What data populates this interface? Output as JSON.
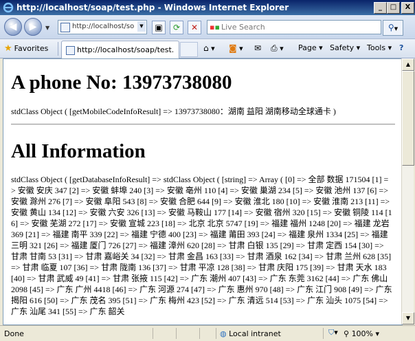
{
  "window": {
    "title": "http://localhost/soap/test.php - Windows Internet Explorer",
    "minimize": "_",
    "maximize": "□",
    "close": "X"
  },
  "nav": {
    "address": "http://localhost/soap/test.php",
    "search_placeholder": "Live Search"
  },
  "tabs": {
    "favorites_label": "Favorites",
    "active_tab": "http://localhost/soap/test.php",
    "page_label": "Page",
    "safety_label": "Safety",
    "tools_label": "Tools"
  },
  "content": {
    "heading1": "A phone No: 13973738080",
    "result1": "stdClass Object ( [getMobileCodeInfoResult] => 13973738080：湖南 益阳 湖南移动全球通卡 )",
    "heading2": "All Information",
    "result2": "stdClass Object ( [getDatabaseInfoResult] => stdClass Object ( [string] => Array ( [0] => 全部 数据 171504 [1] => 安徽 安庆 347 [2] => 安徽 蚌埠 240 [3] => 安徽 亳州 110 [4] => 安徽 巢湖 234 [5] => 安徽 池州 137 [6] => 安徽 滁州 276 [7] => 安徽 阜阳 543 [8] => 安徽 合肥 644 [9] => 安徽 淮北 180 [10] => 安徽 淮南 213 [11] => 安徽 黄山 134 [12] => 安徽 六安 326 [13] => 安徽 马鞍山 177 [14] => 安徽 宿州 320 [15] => 安徽 铜陵 114 [16] => 安徽 芜湖 272 [17] => 安徽 宣城 223 [18] => 北京 北京 5747 [19] => 福建 福州 1248 [20] => 福建 龙岩 369 [21] => 福建 南平 339 [22] => 福建 宁德 400 [23] => 福建 莆田 393 [24] => 福建 泉州 1334 [25] => 福建 三明 321 [26] => 福建 厦门 726 [27] => 福建 漳州 620 [28] => 甘肃 白银 135 [29] => 甘肃 定西 154 [30] => 甘肃 甘南 53 [31] => 甘肃 嘉峪关 34 [32] => 甘肃 金昌 163 [33] => 甘肃 酒泉 162 [34] => 甘肃 兰州 628 [35] => 甘肃 临夏 107 [36] => 甘肃 陇南 136 [37] => 甘肃 平凉 128 [38] => 甘肃 庆阳 175 [39] => 甘肃 天水 183 [40] => 甘肃 武威 49 [41] => 甘肃 张掖 115 [42] => 广东 潮州 407 [43] => 广东 东莞 3162 [44] => 广东 佛山 2098 [45] => 广东 广州 4418 [46] => 广东 河源 274 [47] => 广东 惠州 970 [48] => 广东 江门 908 [49] => 广东 揭阳 616 [50] => 广东 茂名 395 [51] => 广东 梅州 423 [52] => 广东 清远 514 [53] => 广东 汕头 1075 [54] => 广东 汕尾 341 [55] => 广东 韶关"
  },
  "status": {
    "text": "Done",
    "zone": "Local intranet",
    "zoom": "100%"
  }
}
